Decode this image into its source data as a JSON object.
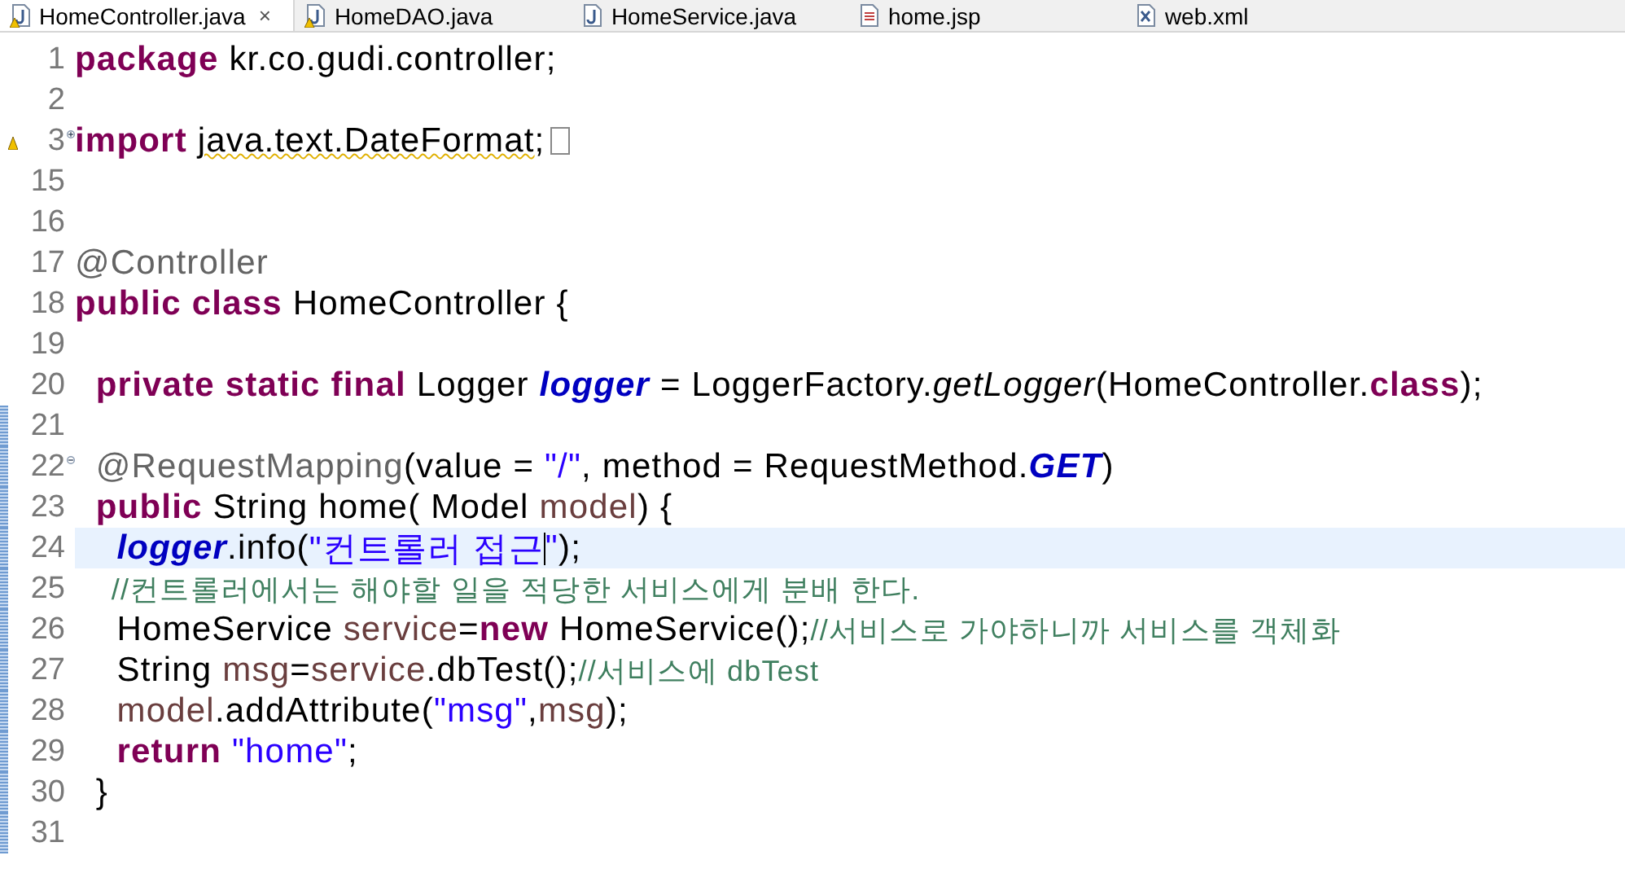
{
  "tabs": [
    {
      "label": "HomeController.java",
      "selected": true,
      "kind": "java",
      "warning": true,
      "close": "×"
    },
    {
      "label": "HomeDAO.java",
      "selected": false,
      "kind": "java",
      "warning": true
    },
    {
      "label": "HomeService.java",
      "selected": false,
      "kind": "java",
      "warning": false
    },
    {
      "label": "home.jsp",
      "selected": false,
      "kind": "jsp",
      "warning": false
    },
    {
      "label": "web.xml",
      "selected": false,
      "kind": "xml",
      "warning": false
    }
  ],
  "lines": [
    {
      "number": "1",
      "changed": false,
      "current": false,
      "tokens": [
        {
          "kind": "kw",
          "text": "package"
        },
        {
          "kind": "plain",
          "text": " kr.co.gudi.controller;"
        }
      ]
    },
    {
      "number": "2",
      "changed": false,
      "current": false
    },
    {
      "number": "3",
      "changed": false,
      "current": false,
      "warning": true,
      "fold_collapsed": true,
      "tokens": [
        {
          "kind": "kw",
          "text": "import "
        },
        {
          "kind": "warned",
          "text": "java.text.DateFormat"
        },
        {
          "kind": "plain",
          "text": ";"
        },
        {
          "kind": "folded"
        }
      ]
    },
    {
      "number": "15",
      "changed": false,
      "current": false
    },
    {
      "number": "16",
      "changed": false,
      "current": false
    },
    {
      "number": "17",
      "changed": false,
      "current": false,
      "tokens": [
        {
          "kind": "ann",
          "text": "@Controller"
        }
      ]
    },
    {
      "number": "18",
      "changed": false,
      "current": false,
      "tokens": [
        {
          "kind": "kw",
          "text": "public class"
        },
        {
          "kind": "plain",
          "text": " HomeController {"
        }
      ]
    },
    {
      "number": "19",
      "changed": false,
      "current": false
    },
    {
      "number": "20",
      "changed": false,
      "current": false,
      "tokens": [
        {
          "kind": "kw",
          "text": "\tprivate static final"
        },
        {
          "kind": "plain",
          "text": " Logger "
        },
        {
          "kind": "field",
          "text": "logger"
        },
        {
          "kind": "plain",
          "text": " = LoggerFactory."
        },
        {
          "kind": "italic",
          "text": "getLogger"
        },
        {
          "kind": "plain",
          "text": "(HomeController."
        },
        {
          "kind": "kw",
          "text": "class"
        },
        {
          "kind": "plain",
          "text": ");"
        }
      ]
    },
    {
      "number": "21",
      "changed": true,
      "current": false
    },
    {
      "number": "22",
      "changed": true,
      "current": false,
      "fold_collapsed": false,
      "tokens": [
        {
          "kind": "ann",
          "text": "\t@RequestMapping"
        },
        {
          "kind": "plain",
          "text": "(value = "
        },
        {
          "kind": "str",
          "text": "\"/\""
        },
        {
          "kind": "plain",
          "text": ", method = RequestMethod."
        },
        {
          "kind": "field",
          "text": "GET"
        },
        {
          "kind": "plain",
          "text": ")"
        }
      ]
    },
    {
      "number": "23",
      "changed": true,
      "current": false,
      "tokens": [
        {
          "kind": "kw",
          "text": "\tpublic"
        },
        {
          "kind": "plain",
          "text": " String home( Model "
        },
        {
          "kind": "local",
          "text": "model"
        },
        {
          "kind": "plain",
          "text": ") {"
        }
      ]
    },
    {
      "number": "24",
      "changed": true,
      "current": true,
      "tokens": [
        {
          "kind": "field",
          "text": "\t\tlogger"
        },
        {
          "kind": "plain",
          "text": ".info("
        },
        {
          "kind": "str",
          "text": "\"컨트롤러 접근"
        },
        {
          "kind": "caret"
        },
        {
          "kind": "str",
          "text": "\""
        },
        {
          "kind": "plain",
          "text": ");"
        }
      ]
    },
    {
      "number": "25",
      "changed": true,
      "current": false,
      "tokens": [
        {
          "kind": "comment",
          "text": "\t\t//컨트롤러에서는 해야할 일을 적당한 서비스에게 분배 한다."
        }
      ]
    },
    {
      "number": "26",
      "changed": true,
      "current": false,
      "tokens": [
        {
          "kind": "plain",
          "text": "\t\tHomeService "
        },
        {
          "kind": "local",
          "text": "service"
        },
        {
          "kind": "plain",
          "text": "="
        },
        {
          "kind": "kw",
          "text": "new"
        },
        {
          "kind": "plain",
          "text": " HomeService();"
        },
        {
          "kind": "comment",
          "text": "//서비스로 가야하니까 서비스를 객체화"
        }
      ]
    },
    {
      "number": "27",
      "changed": true,
      "current": false,
      "tokens": [
        {
          "kind": "plain",
          "text": "\t\tString "
        },
        {
          "kind": "local",
          "text": "msg"
        },
        {
          "kind": "plain",
          "text": "="
        },
        {
          "kind": "local",
          "text": "service"
        },
        {
          "kind": "plain",
          "text": ".dbTest();"
        },
        {
          "kind": "comment",
          "text": "//서비스에 dbTest"
        }
      ]
    },
    {
      "number": "28",
      "changed": true,
      "current": false,
      "tokens": [
        {
          "kind": "local",
          "text": "\t\tmodel"
        },
        {
          "kind": "plain",
          "text": ".addAttribute("
        },
        {
          "kind": "str",
          "text": "\"msg\""
        },
        {
          "kind": "plain",
          "text": ","
        },
        {
          "kind": "local",
          "text": "msg"
        },
        {
          "kind": "plain",
          "text": ");"
        }
      ]
    },
    {
      "number": "29",
      "changed": true,
      "current": false,
      "tokens": [
        {
          "kind": "kw",
          "text": "\t\treturn "
        },
        {
          "kind": "str",
          "text": "\"home\""
        },
        {
          "kind": "plain",
          "text": ";"
        }
      ]
    },
    {
      "number": "30",
      "changed": true,
      "current": false,
      "tokens": [
        {
          "kind": "plain",
          "text": "\t}"
        }
      ]
    },
    {
      "number": "31",
      "changed": true,
      "current": false
    }
  ]
}
